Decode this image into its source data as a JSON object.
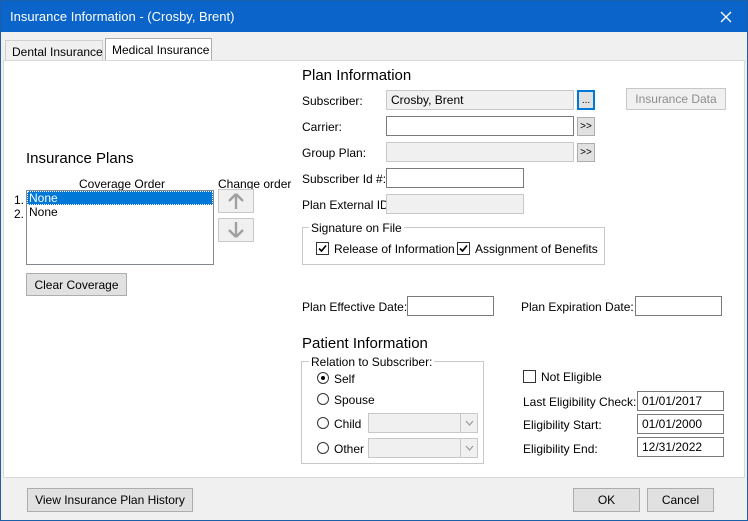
{
  "window": {
    "title": "Insurance Information - (Crosby, Brent)"
  },
  "tabs": [
    {
      "label": "Dental Insurance",
      "active": false
    },
    {
      "label": "Medical Insurance",
      "active": true
    }
  ],
  "insurance_plans": {
    "heading": "Insurance Plans",
    "column_header": "Coverage Order",
    "change_order_label": "Change order",
    "items": [
      {
        "number": "1.",
        "label": "None",
        "selected": true
      },
      {
        "number": "2.",
        "label": "None",
        "selected": false
      }
    ],
    "clear_coverage_label": "Clear Coverage"
  },
  "plan_information": {
    "heading": "Plan Information",
    "subscriber_label": "Subscriber:",
    "subscriber_value": "Crosby, Brent",
    "subscriber_picker_label": "...",
    "insurance_data_label": "Insurance Data",
    "carrier_label": "Carrier:",
    "carrier_value": "",
    "carrier_more_label": ">>",
    "group_plan_label": "Group Plan:",
    "group_plan_value": "",
    "group_plan_more_label": ">>",
    "subscriber_id_label": "Subscriber Id #:",
    "subscriber_id_value": "",
    "plan_external_id_label": "Plan External ID:",
    "plan_external_id_value": ""
  },
  "signature_on_file": {
    "heading": "Signature on File",
    "release_label": "Release of Information",
    "release_checked": true,
    "assignment_label": "Assignment of Benefits",
    "assignment_checked": true
  },
  "plan_dates": {
    "effective_label": "Plan Effective Date:",
    "effective_value": "",
    "expiration_label": "Plan Expiration Date:",
    "expiration_value": ""
  },
  "patient_information": {
    "heading": "Patient Information",
    "relation_heading": "Relation to Subscriber:",
    "self_label": "Self",
    "spouse_label": "Spouse",
    "child_label": "Child",
    "other_label": "Other",
    "selected_relation": "Self",
    "child_combo_value": "",
    "other_combo_value": ""
  },
  "eligibility": {
    "not_eligible_label": "Not Eligible",
    "not_eligible_checked": false,
    "last_check_label": "Last Eligibility Check:",
    "last_check_value": "01/01/2017",
    "start_label": "Eligibility Start:",
    "start_value": "01/01/2000",
    "end_label": "Eligibility End:",
    "end_value": "12/31/2022"
  },
  "footer": {
    "history_label": "View Insurance Plan History",
    "ok_label": "OK",
    "cancel_label": "Cancel"
  },
  "icons": {
    "close": "close-icon",
    "up": "arrow-up-icon",
    "down": "arrow-down-icon",
    "dropdown": "chevron-down-icon",
    "check": "checkmark-icon"
  },
  "colors": {
    "titlebar": "#0a64c9",
    "selection": "#0078d7",
    "dialog_bg": "#f0f0f0"
  }
}
